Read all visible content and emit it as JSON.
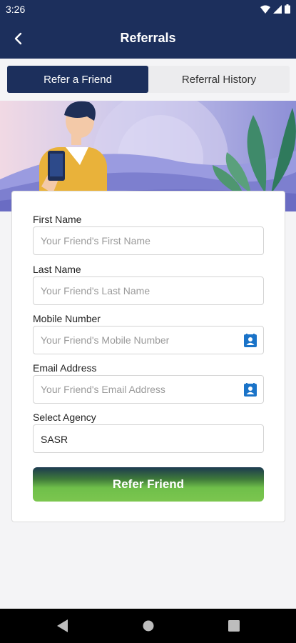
{
  "status_bar": {
    "time": "3:26",
    "icons": [
      "wifi-icon",
      "signal-icon",
      "battery-icon"
    ]
  },
  "app_bar": {
    "title": "Referrals",
    "back_icon": "back-arrow-icon"
  },
  "tabs": [
    {
      "label": "Refer a Friend",
      "active": true
    },
    {
      "label": "Referral History",
      "active": false
    }
  ],
  "form": {
    "first_name": {
      "label": "First Name",
      "placeholder": "Your Friend's First Name",
      "value": ""
    },
    "last_name": {
      "label": "Last Name",
      "placeholder": "Your Friend's Last Name",
      "value": ""
    },
    "mobile": {
      "label": "Mobile Number",
      "placeholder": "Your Friend's Mobile Number",
      "value": "",
      "icon": "contact-book-icon"
    },
    "email": {
      "label": "Email Address",
      "placeholder": "Your Friend's Email Address",
      "value": "",
      "icon": "contact-book-icon"
    },
    "agency": {
      "label": "Select Agency",
      "value": "SASR"
    },
    "submit_label": "Refer Friend"
  },
  "colors": {
    "primary": "#1c2f5c",
    "button_green": "#6fbf4a",
    "icon_blue": "#1a73c8"
  },
  "nav_bar": {
    "icons": [
      "nav-back-icon",
      "nav-home-icon",
      "nav-recents-icon"
    ]
  }
}
